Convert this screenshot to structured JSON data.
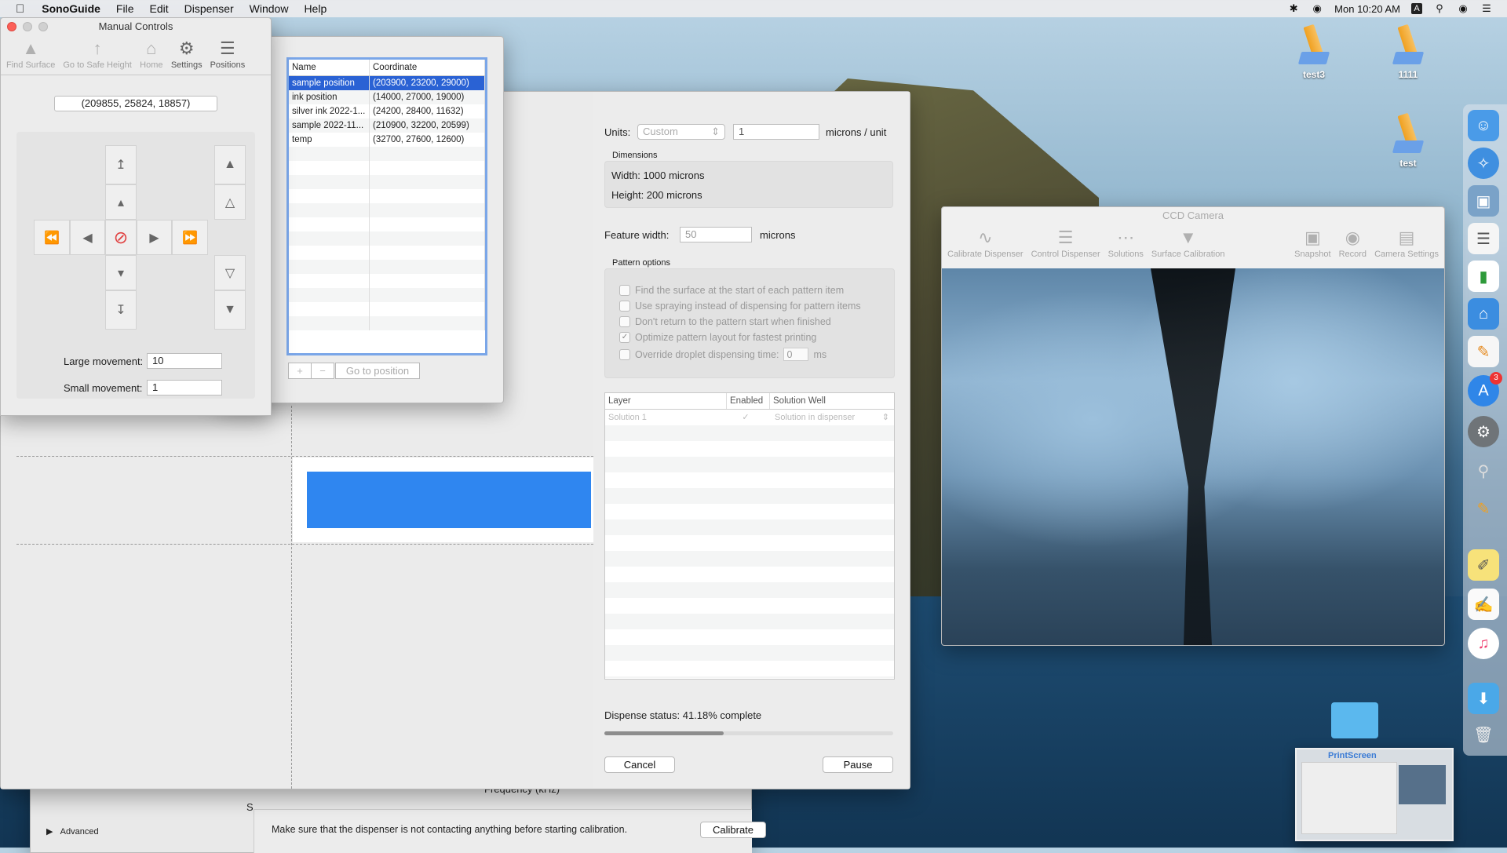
{
  "menubar": {
    "app_name": "SonoGuide",
    "items": [
      "File",
      "Edit",
      "Dispenser",
      "Window",
      "Help"
    ],
    "clock": "Mon 10:20 AM",
    "input_source": "A"
  },
  "desktop": {
    "icons": [
      "test3",
      "1111",
      "test"
    ]
  },
  "dock": {
    "app_store_badge": "3"
  },
  "manual_controls": {
    "title": "Manual Controls",
    "toolbar": {
      "find_surface": "Find Surface",
      "safe_height": "Go to Safe Height",
      "home": "Home",
      "settings": "Settings",
      "positions": "Positions"
    },
    "coordinate": "(209855, 25824, 18857)",
    "large_movement_label": "Large movement:",
    "large_movement_value": "10",
    "small_movement_label": "Small movement:",
    "small_movement_value": "1"
  },
  "positions": {
    "col_name": "Name",
    "col_coordinate": "Coordinate",
    "rows": [
      {
        "name": "sample position",
        "coordinate": "(203900, 23200, 29000)"
      },
      {
        "name": "ink position",
        "coordinate": "(14000, 27000, 19000)"
      },
      {
        "name": "silver ink 2022-1...",
        "coordinate": "(24200, 28400, 11632)"
      },
      {
        "name": "sample 2022-11...",
        "coordinate": "(210900, 32200, 20599)"
      },
      {
        "name": "temp",
        "coordinate": "(32700, 27600, 12600)"
      }
    ],
    "add": "+",
    "remove": "−",
    "go_to_position": "Go to position"
  },
  "pattern": {
    "units_label": "Units:",
    "units_select": "Custom",
    "units_value": "1",
    "units_suffix": "microns / unit",
    "dimensions_title": "Dimensions",
    "width": "Width: 1000 microns",
    "height": "Height: 200 microns",
    "feature_width_label": "Feature width:",
    "feature_width_value": "50",
    "feature_width_unit": "microns",
    "options_title": "Pattern options",
    "options": {
      "find_surface": "Find the surface at the start of each pattern item",
      "use_spraying": "Use spraying instead of dispensing for pattern items",
      "dont_return": "Don't return to the pattern start when finished",
      "optimize": "Optimize pattern layout for fastest printing",
      "override": "Override droplet dispensing time:",
      "override_value": "0",
      "override_unit": "ms"
    },
    "layer_cols": {
      "layer": "Layer",
      "enabled": "Enabled",
      "solution_well": "Solution Well"
    },
    "layer_row": {
      "layer": "Solution 1",
      "enabled": "✓",
      "well": "Solution in dispenser"
    },
    "status": "Dispense status: 41.18% complete",
    "progress": 0.4118,
    "cancel": "Cancel",
    "pause": "Pause"
  },
  "camera": {
    "title": "CCD Camera",
    "toolbar": {
      "calibrate_dispenser": "Calibrate Dispenser",
      "control_dispenser": "Control Dispenser",
      "solutions": "Solutions",
      "surface_calibration": "Surface Calibration",
      "snapshot": "Snapshot",
      "record": "Record",
      "camera_settings": "Camera Settings"
    }
  },
  "calibration": {
    "frequency_label": "Frequency (kHz)",
    "advanced": "Advanced",
    "s_label": "S",
    "message": "Make sure that the dispenser is not contacting anything before starting calibration.",
    "calibrate": "Calibrate"
  },
  "thumbnail": {
    "label": "PrintScreen"
  }
}
